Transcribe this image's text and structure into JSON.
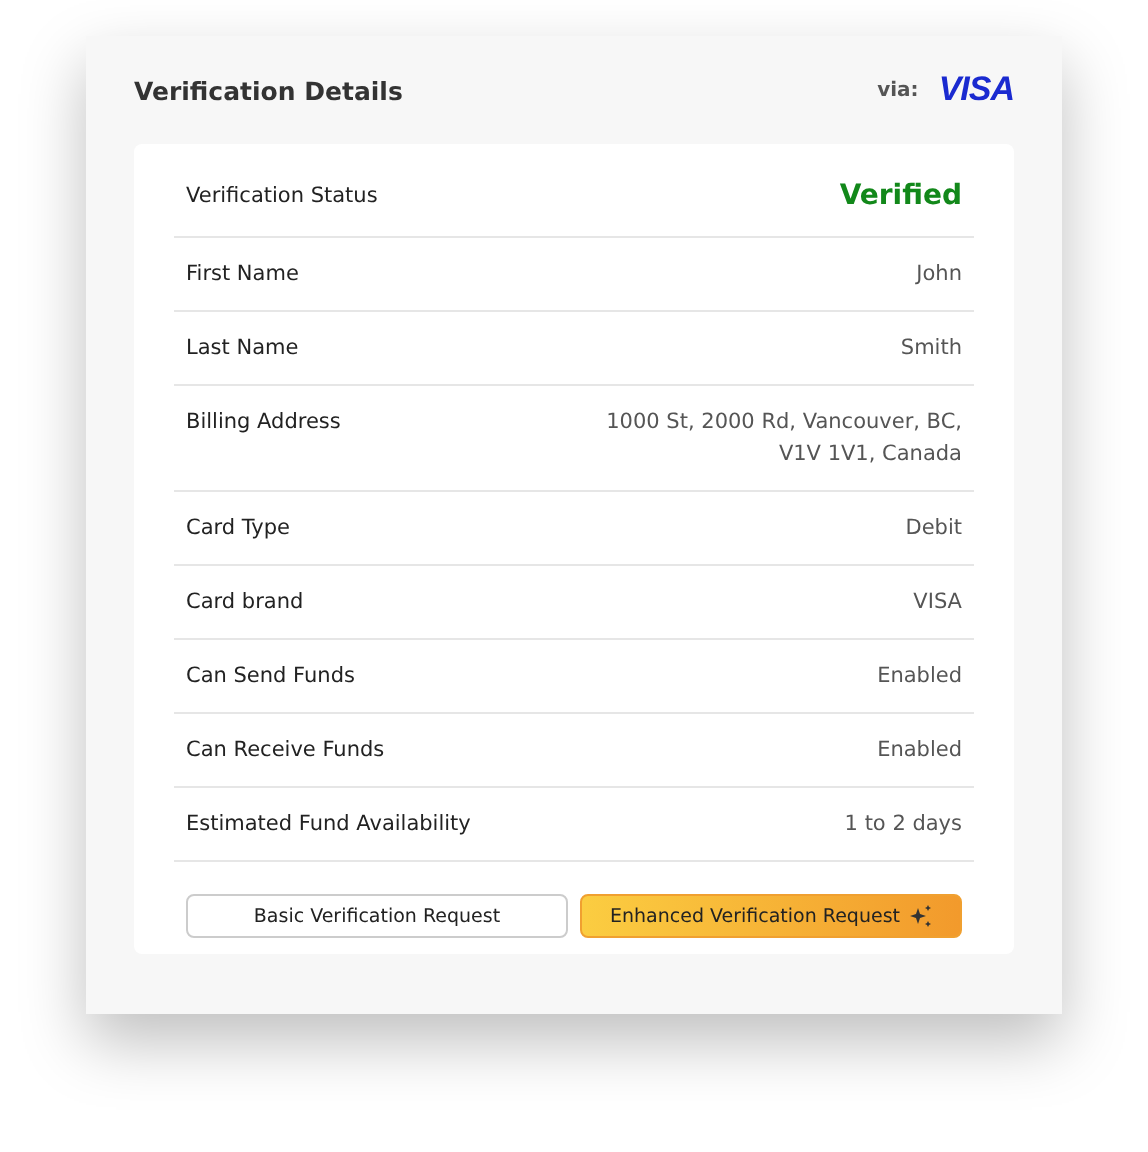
{
  "header": {
    "title": "Verification Details",
    "via": "via:",
    "brand": "VISA"
  },
  "status": {
    "label": "Verification Status",
    "value": "Verified"
  },
  "rows": [
    {
      "label": "First Name",
      "value": "John"
    },
    {
      "label": "Last Name",
      "value": "Smith"
    },
    {
      "label": "Billing Address",
      "value": "1000 St, 2000 Rd, Vancouver, BC, V1V 1V1, Canada"
    },
    {
      "label": "Card Type",
      "value": "Debit"
    },
    {
      "label": "Card brand",
      "value": "VISA"
    },
    {
      "label": "Can Send Funds",
      "value": "Enabled"
    },
    {
      "label": "Can Receive Funds",
      "value": "Enabled"
    },
    {
      "label": "Estimated Fund Availability",
      "value": "1 to 2 days"
    }
  ],
  "buttons": [
    {
      "label": "Basic Verification Request",
      "kind": "plain"
    },
    {
      "label": "Enhanced Verification Request",
      "kind": "enhanced"
    }
  ]
}
